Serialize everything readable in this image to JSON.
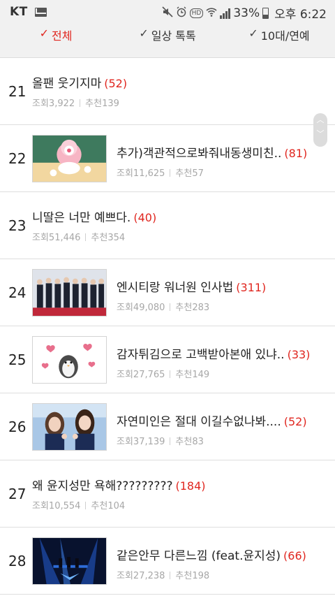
{
  "status_bar": {
    "carrier": "KT",
    "battery_percent": "33%",
    "time": "오후 6:22",
    "hd_label": "HD",
    "icons": [
      "mail-icon",
      "mute-icon",
      "alarm-icon",
      "hd-icon",
      "wifi-icon",
      "signal-icon",
      "battery-icon"
    ]
  },
  "tabs": [
    {
      "label": "전체",
      "active": true
    },
    {
      "label": "일상 톡톡",
      "active": false
    },
    {
      "label": "10대/연예",
      "active": false
    }
  ],
  "labels": {
    "views": "조회",
    "recommends": "추천"
  },
  "accent_color": "#e0261f",
  "rows": [
    {
      "rank": "21",
      "title": "올팬 웃기지마",
      "count": "(52)",
      "views": "3,922",
      "recommends": "139",
      "has_thumb": false
    },
    {
      "rank": "22",
      "title": "추가)객관적으로봐줘내동생미친..",
      "count": "(81)",
      "views": "11,625",
      "recommends": "57",
      "has_thumb": true
    },
    {
      "rank": "23",
      "title": "니딸은 너만 예쁘다.",
      "count": "(40)",
      "views": "51,446",
      "recommends": "354",
      "has_thumb": false
    },
    {
      "rank": "24",
      "title": "엔시티랑 워너원 인사법",
      "count": "(311)",
      "views": "49,080",
      "recommends": "283",
      "has_thumb": true
    },
    {
      "rank": "25",
      "title": "감자튀김으로 고백받아본애 있냐..",
      "count": "(33)",
      "views": "27,765",
      "recommends": "149",
      "has_thumb": true
    },
    {
      "rank": "26",
      "title": "자연미인은 절대 이길수없나봐....",
      "count": "(52)",
      "views": "37,139",
      "recommends": "83",
      "has_thumb": true
    },
    {
      "rank": "27",
      "title": "왜 윤지성만 욕해?????????",
      "count": "(184)",
      "views": "10,554",
      "recommends": "104",
      "has_thumb": false
    },
    {
      "rank": "28",
      "title": "같은안무 다른느낌 (feat.윤지성)",
      "count": "(66)",
      "views": "27,238",
      "recommends": "198",
      "has_thumb": true
    }
  ]
}
